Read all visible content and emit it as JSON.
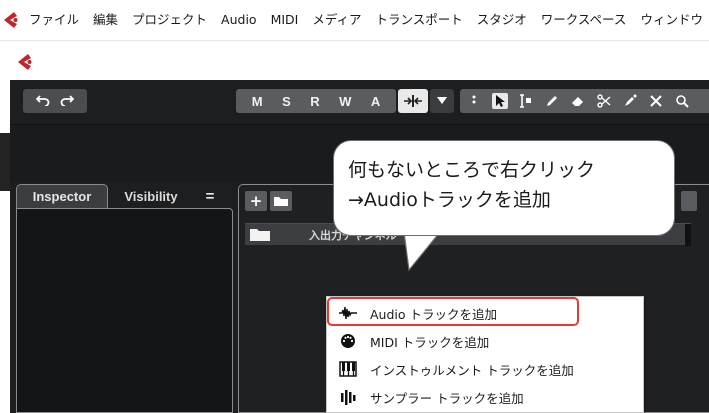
{
  "menubar": {
    "items": [
      "ファイル",
      "編集",
      "プロジェクト",
      "Audio",
      "MIDI",
      "メディア",
      "トランスポート",
      "スタジオ",
      "ワークスペース",
      "ウィンドウ"
    ]
  },
  "toolbar": {
    "undo_icon": "undo-icon",
    "redo_icon": "redo-icon",
    "msrwa": [
      "M",
      "S",
      "R",
      "W",
      "A"
    ]
  },
  "inspector": {
    "tabs": [
      "Inspector",
      "Visibility",
      "="
    ]
  },
  "project": {
    "add_label": "+",
    "track_name": "入出力チャンネル"
  },
  "context_menu": {
    "items": [
      {
        "icon": "audio-waveform-icon",
        "label": "Audio トラックを追加"
      },
      {
        "icon": "midi-connector-icon",
        "label": "MIDI トラックを追加"
      },
      {
        "icon": "piano-keys-icon",
        "label": "インストゥルメント トラックを追加"
      },
      {
        "icon": "sampler-bars-icon",
        "label": "サンプラー トラックを追加"
      }
    ]
  },
  "callout": {
    "line1": "何もないところで右クリック",
    "line2": "→Audioトラックを追加"
  },
  "colors": {
    "accent_red": "#e53935",
    "window_bg": "#1d1e20",
    "cubase_logo": "#c0262d"
  }
}
